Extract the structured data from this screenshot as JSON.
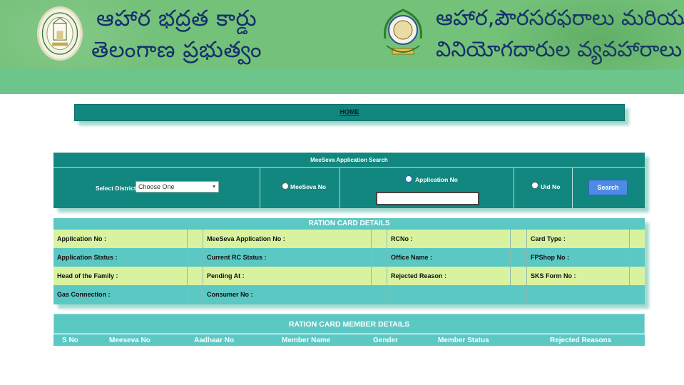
{
  "header": {
    "left_title_line1": "ఆహార భద్రత కార్డు",
    "left_title_line2": "తెలంగాణ ప్రభుత్వం",
    "right_title_line1": "ఆహార,పౌరసరఫరాలు మరియు",
    "right_title_line2": "వినియోగదారుల వ్యవహారాలు",
    "left_emblem": "telangana-emblem",
    "right_emblem": "civil-supplies-logo"
  },
  "nav": {
    "home_label": "HOME"
  },
  "search": {
    "title": "MeeSeva Application Search",
    "district_label": "Select District :",
    "district_value": "Choose One",
    "options": {
      "meeseva_no": "MeeSeva No",
      "application_no": "Application No",
      "uid_no": "Uid No"
    },
    "selected_option": "application_no",
    "application_input_value": "",
    "search_button": "Search"
  },
  "ration_card": {
    "title": "RATION CARD DETAILS",
    "rows": [
      [
        "Application No :",
        "MeeSeva Application No :",
        "RCNo :",
        "Card Type :"
      ],
      [
        "Application Status :",
        "Current RC Status :",
        "Office Name :",
        "FPShop No :"
      ],
      [
        "Head of the Family :",
        "Pending At :",
        "Rejected Reason :",
        "SKS Form No :"
      ],
      [
        "Gas Connection :",
        "Consumer No :",
        "",
        ""
      ]
    ]
  },
  "members": {
    "title": "RATION CARD MEMBER DETAILS",
    "columns": [
      "S No",
      "Meeseva No",
      "Aadhaar No",
      "Member Name",
      "Gender",
      "Member Status",
      "Rejected Reasons"
    ]
  },
  "colors": {
    "banner": "#74c179",
    "teal_dark": "#11877f",
    "teal_light": "#5bc8c4",
    "row_yellow": "#d9f2a0",
    "title_text": "#15306b",
    "button": "#4d8be6"
  }
}
